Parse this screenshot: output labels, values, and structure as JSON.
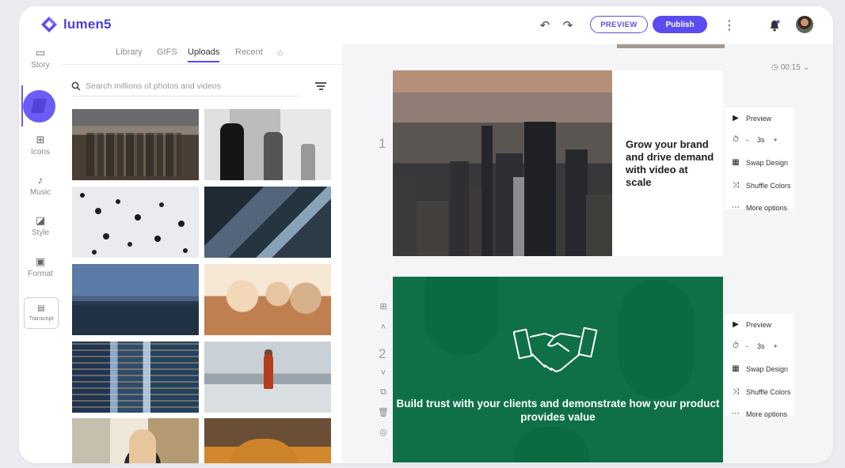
{
  "brand": {
    "name": "lumen5",
    "color": "#5b4cf0"
  },
  "header": {
    "preview_label": "PREVIEW",
    "publish_label": "Publish"
  },
  "sidebar": {
    "items": [
      {
        "label": "Story",
        "icon": "story-icon"
      },
      {
        "label": "",
        "icon": "media-icon"
      },
      {
        "label": "Icons",
        "icon": "icons-icon"
      },
      {
        "label": "Music",
        "icon": "music-note-icon"
      },
      {
        "label": "Style",
        "icon": "style-icon"
      },
      {
        "label": "Format",
        "icon": "format-icon"
      },
      {
        "label": "Transcript",
        "icon": "transcript-icon"
      }
    ]
  },
  "library": {
    "tabs": [
      "Library",
      "GIFS",
      "Uploads",
      "Recent"
    ],
    "active_tab": "Uploads",
    "search_placeholder": "Search millions of photos and videos"
  },
  "canvas": {
    "duration": "00:15",
    "scenes": [
      {
        "number": "1",
        "text": "Grow your brand and drive demand with video at scale",
        "menu": {
          "preview": "Preview",
          "duration": "3s",
          "swap": "Swap Design",
          "shuffle": "Shuffle Colors",
          "more": "More options"
        }
      },
      {
        "number": "2",
        "text": "Build trust with your clients and demonstrate how your product provides value",
        "menu": {
          "preview": "Preview",
          "duration": "3s",
          "swap": "Swap Design",
          "shuffle": "Shuffle Colors",
          "more": "More options"
        }
      }
    ]
  }
}
